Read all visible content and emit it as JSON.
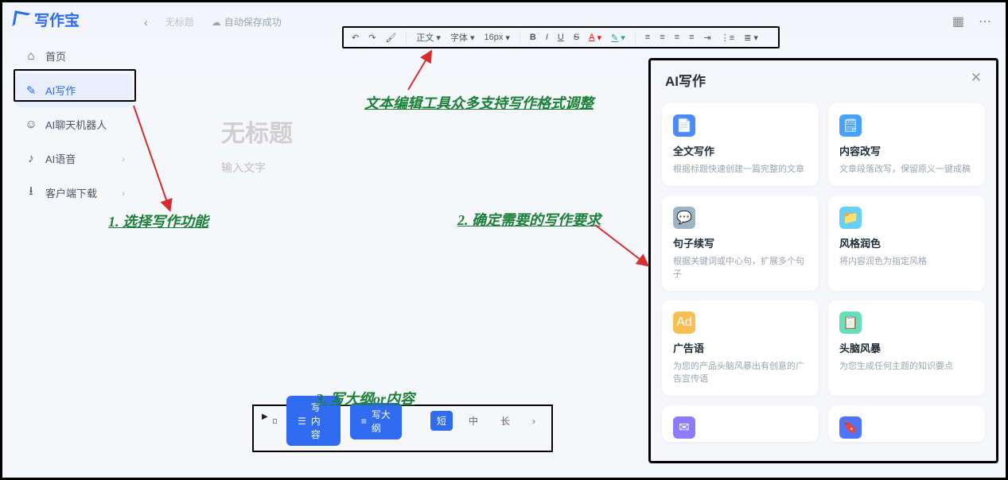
{
  "brand": "写作宝",
  "topbar": {
    "untitled": "无标题",
    "autosave": "自动保存成功"
  },
  "sidebar": {
    "items": [
      {
        "label": "首页"
      },
      {
        "label": "AI写作"
      },
      {
        "label": "AI聊天机器人"
      },
      {
        "label": "AI语音"
      },
      {
        "label": "客户端下载"
      }
    ]
  },
  "toolbar": {
    "format_label": "正文",
    "font_label": "字体",
    "size_label": "16px"
  },
  "doc": {
    "title_placeholder": "无标题",
    "body_placeholder": "输入文字"
  },
  "bottom": {
    "write_content": "写内容",
    "write_outline": "写大纲",
    "len_short": "短",
    "len_mid": "中",
    "len_long": "长"
  },
  "ai_panel": {
    "title": "AI写作",
    "cards": [
      {
        "title": "全文写作",
        "desc": "根据标题快速创建一篇完整的文章"
      },
      {
        "title": "内容改写",
        "desc": "文章段落改写，保留原义一键成稿"
      },
      {
        "title": "句子续写",
        "desc": "根据关键词或中心句，扩展多个句子"
      },
      {
        "title": "风格润色",
        "desc": "将内容润色为指定风格"
      },
      {
        "title": "广告语",
        "desc": "为您的产品头脑风暴出有创意的广告宣传语"
      },
      {
        "title": "头脑风暴",
        "desc": "为您生成任何主题的知识要点"
      }
    ]
  },
  "annotations": {
    "a1": "1. 选择写作功能",
    "a2": "2. 确定需要的写作要求",
    "a3": "3. 写大纲or内容",
    "a_toolbar": "文本编辑工具众多支持写作格式调整"
  }
}
